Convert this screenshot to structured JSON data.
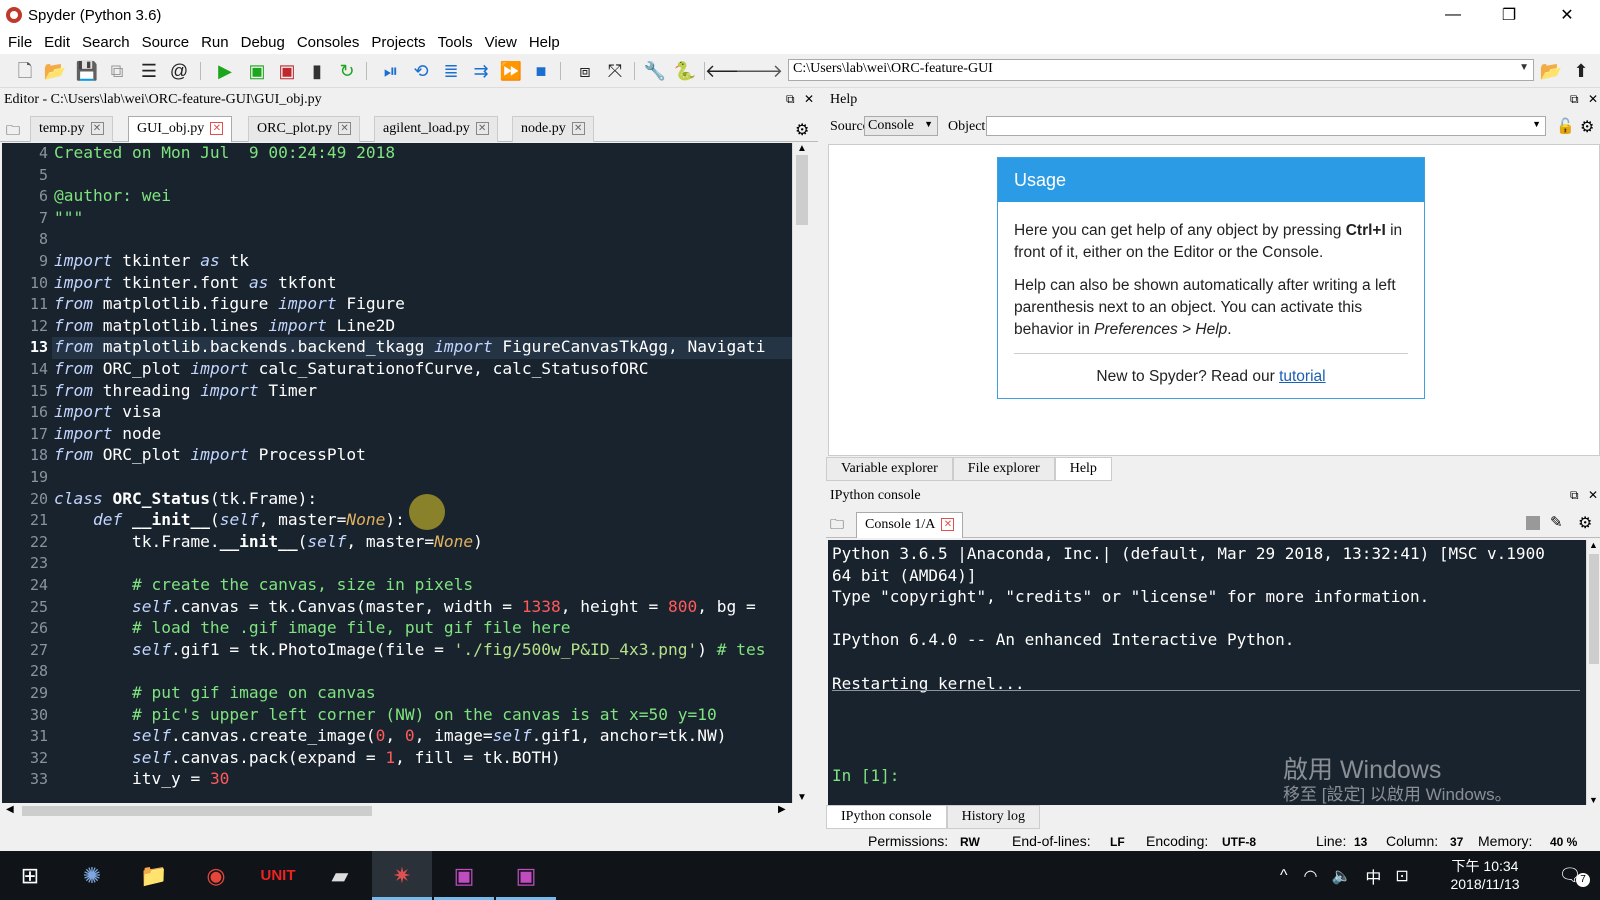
{
  "window": {
    "title": "Spyder (Python 3.6)",
    "minimize": "—",
    "maximize": "❐",
    "close": "✕"
  },
  "menu": [
    "File",
    "Edit",
    "Search",
    "Source",
    "Run",
    "Debug",
    "Consoles",
    "Projects",
    "Tools",
    "View",
    "Help"
  ],
  "toolbar": {
    "path": "C:\\Users\\lab\\wei\\ORC-feature-GUI"
  },
  "editor": {
    "title": "Editor - C:\\Users\\lab\\wei\\ORC-feature-GUI\\GUI_obj.py",
    "tabs": [
      "temp.py",
      "GUI_obj.py",
      "ORC_plot.py",
      "agilent_load.py",
      "node.py"
    ],
    "active_tab": "GUI_obj.py",
    "line_numbers": [
      "4",
      "5",
      "6",
      "7",
      "8",
      "9",
      "10",
      "11",
      "12",
      "13",
      "14",
      "15",
      "16",
      "17",
      "18",
      "19",
      "20",
      "21",
      "22",
      "23",
      "24",
      "25",
      "26",
      "27",
      "28",
      "29",
      "30",
      "31",
      "32",
      "33"
    ],
    "current_line": "13",
    "lines": [
      "Created on Mon Jul  9 00:24:49 2018",
      "",
      "@author: wei",
      "\"\"\"",
      "",
      "import tkinter as tk",
      "import tkinter.font as tkfont",
      "from matplotlib.figure import Figure",
      "from matplotlib.lines import Line2D",
      "from matplotlib.backends.backend_tkagg import FigureCanvasTkAgg, Navigati",
      "from ORC_plot import calc_SaturationofCurve, calc_StatusofORC",
      "from threading import Timer",
      "import visa",
      "import node",
      "from ORC_plot import ProcessPlot",
      "",
      "class ORC_Status(tk.Frame):",
      "    def __init__(self, master=None):",
      "        tk.Frame.__init__(self, master=None)",
      "",
      "        # create the canvas, size in pixels",
      "        self.canvas = tk.Canvas(master, width = 1338, height = 800, bg =",
      "        # load the .gif image file, put gif file here",
      "        self.gif1 = tk.PhotoImage(file = './fig/500w_P&ID_4x3.png') # tes",
      "",
      "        # put gif image on canvas",
      "        # pic's upper left corner (NW) on the canvas is at x=50 y=10",
      "        self.canvas.create_image(0, 0, image=self.gif1, anchor=tk.NW)",
      "        self.canvas.pack(expand = 1, fill = tk.BOTH)",
      "        itv_y = 30"
    ]
  },
  "help": {
    "title": "Help",
    "source_label": "Source",
    "source_value": "Console",
    "object_label": "Object",
    "usage_title": "Usage",
    "para1_a": "Here you can get help of any object by pressing ",
    "para1_key": "Ctrl+I",
    "para1_b": " in front of it, either on the Editor or the Console.",
    "para2_a": "Help can also be shown automatically after writing a left parenthesis next to an object. You can activate this behavior in ",
    "para2_pref": "Preferences > Help",
    "para2_b": ".",
    "new_text": "New to Spyder? Read our ",
    "tutorial_link": "tutorial",
    "bottom_tabs": [
      "Variable explorer",
      "File explorer",
      "Help"
    ]
  },
  "console": {
    "title": "IPython console",
    "tab": "Console 1/A",
    "lines": [
      "Python 3.6.5 |Anaconda, Inc.| (default, Mar 29 2018, 13:32:41) [MSC v.1900",
      "64 bit (AMD64)]",
      "Type \"copyright\", \"credits\" or \"license\" for more information.",
      "",
      "IPython 6.4.0 -- An enhanced Interactive Python.",
      "",
      "Restarting kernel..."
    ],
    "prompt": "In [1]:",
    "bottom_tabs": [
      "IPython console",
      "History log"
    ]
  },
  "status": {
    "permissions_label": "Permissions:",
    "permissions": "RW",
    "eol_label": "End-of-lines:",
    "eol": "LF",
    "encoding_label": "Encoding:",
    "encoding": "UTF-8",
    "line_label": "Line:",
    "line": "13",
    "column_label": "Column:",
    "column": "37",
    "memory_label": "Memory:",
    "memory": "40 %"
  },
  "watermark": {
    "line1": "啟用 Windows",
    "line2": "移至 [設定] 以啟用 Windows。"
  },
  "taskbar": {
    "time_period": "下午 10:34",
    "date": "2018/11/13",
    "ime": "中",
    "notifications": "7"
  },
  "colors": {
    "editor_bg": "#19232d",
    "accent": "#2c9be6"
  }
}
